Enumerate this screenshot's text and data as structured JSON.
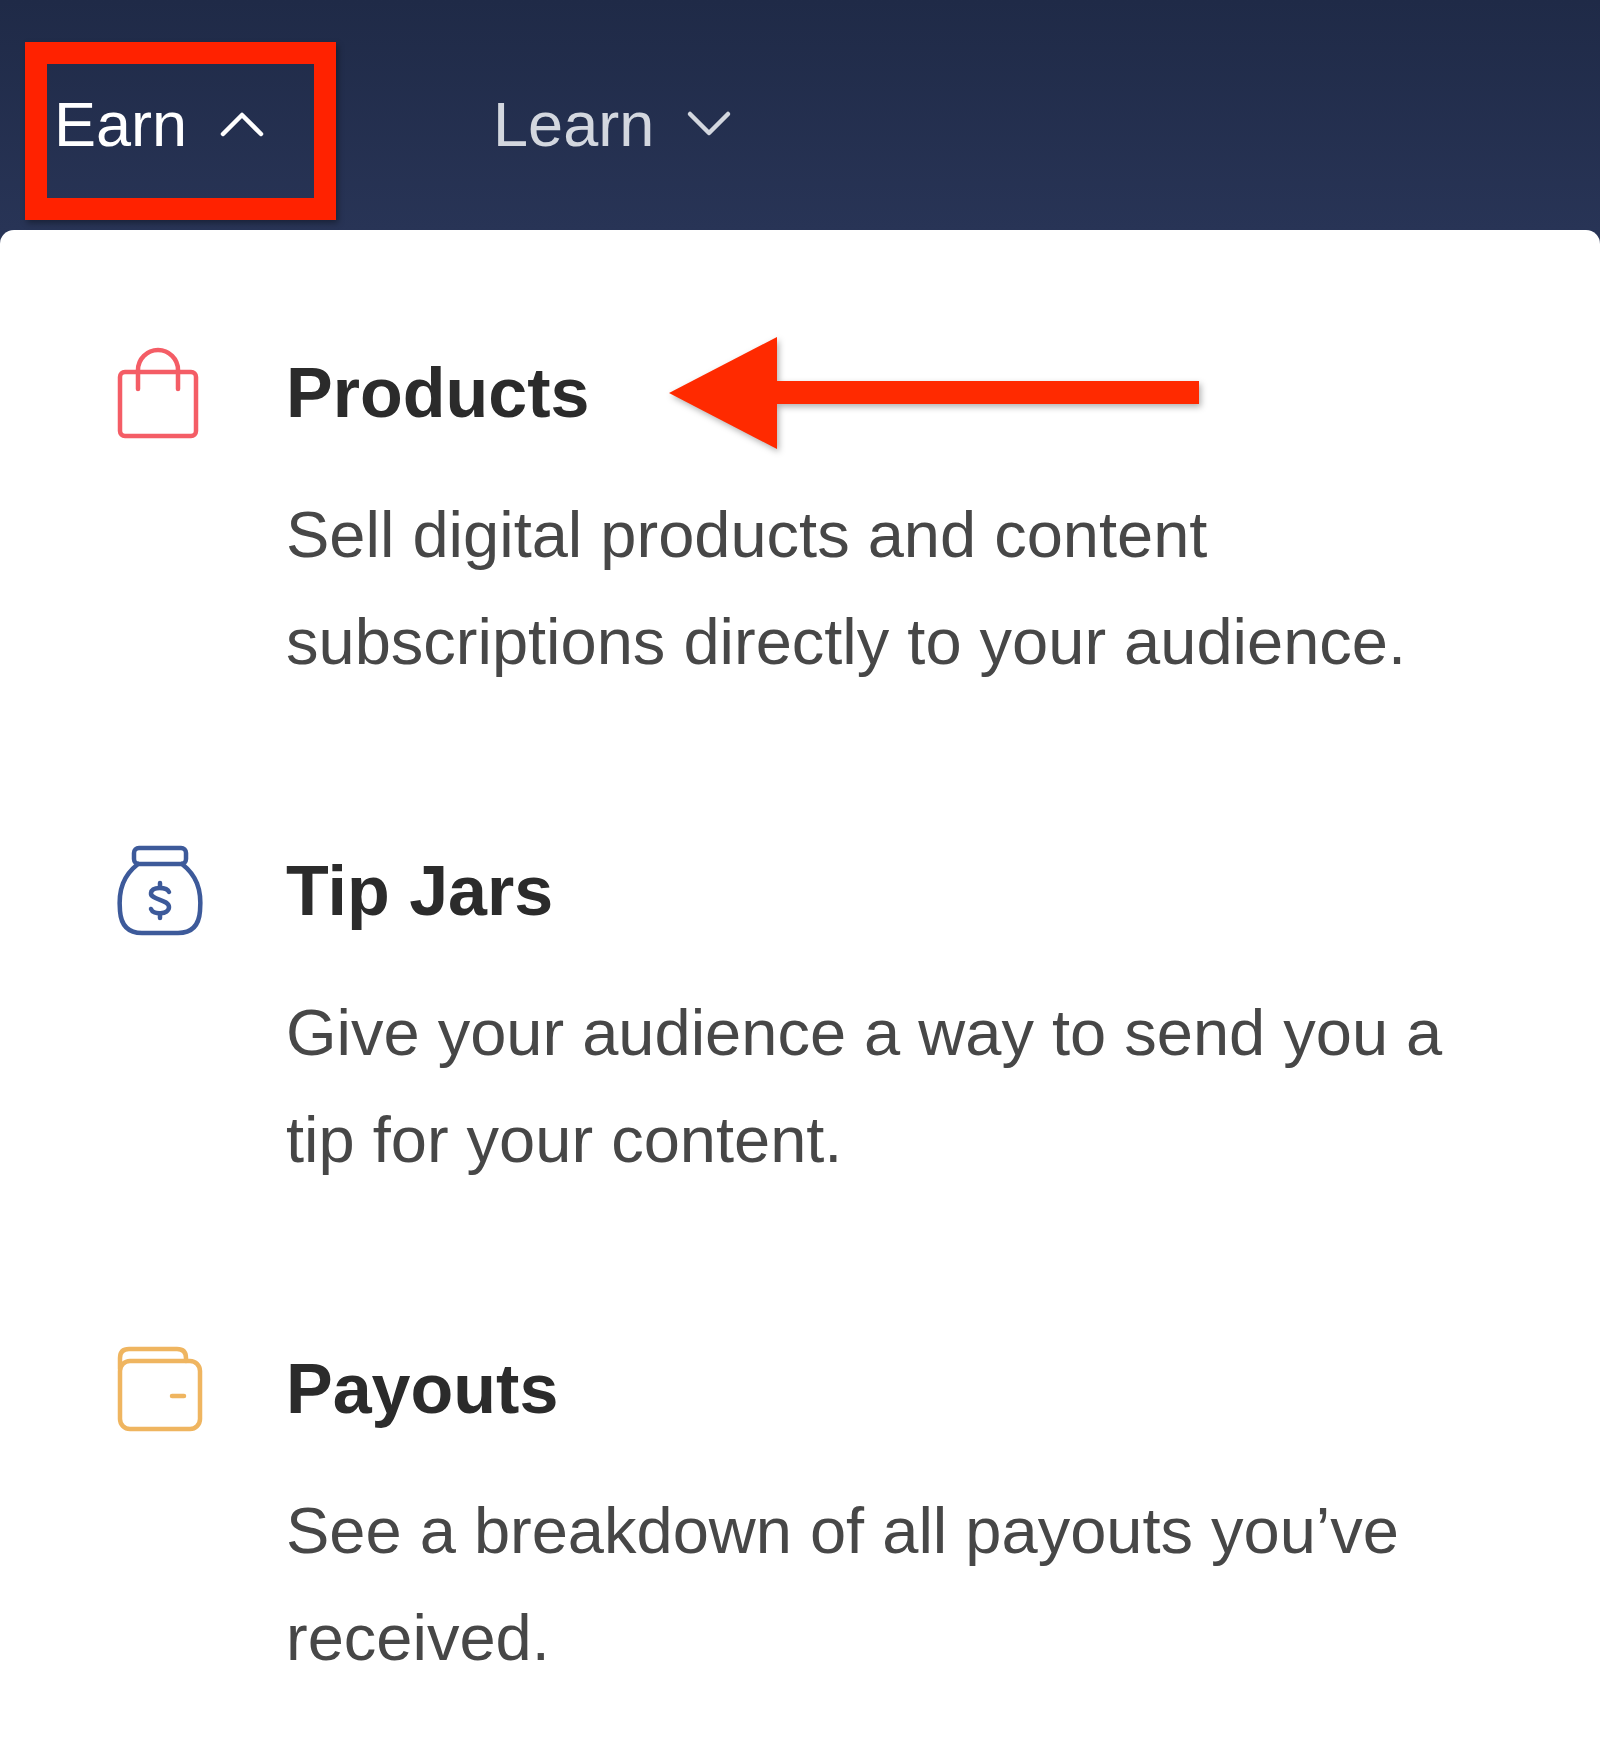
{
  "nav": {
    "items": [
      {
        "label": "Earn",
        "expanded": true,
        "highlighted": true
      },
      {
        "label": "Learn",
        "expanded": false,
        "highlighted": false
      }
    ]
  },
  "menu": {
    "items": [
      {
        "title": "Products",
        "description": "Sell digital products and content subscriptions directly to your audience.",
        "color": "#f45d66",
        "pointed_at": true
      },
      {
        "title": "Tip Jars",
        "description": "Give your audience a way to send you a tip for your content.",
        "color": "#3d5a9a",
        "pointed_at": false
      },
      {
        "title": "Payouts",
        "description": "See a breakdown of all payouts you’ve received.",
        "color": "#efb560",
        "pointed_at": false
      }
    ]
  }
}
